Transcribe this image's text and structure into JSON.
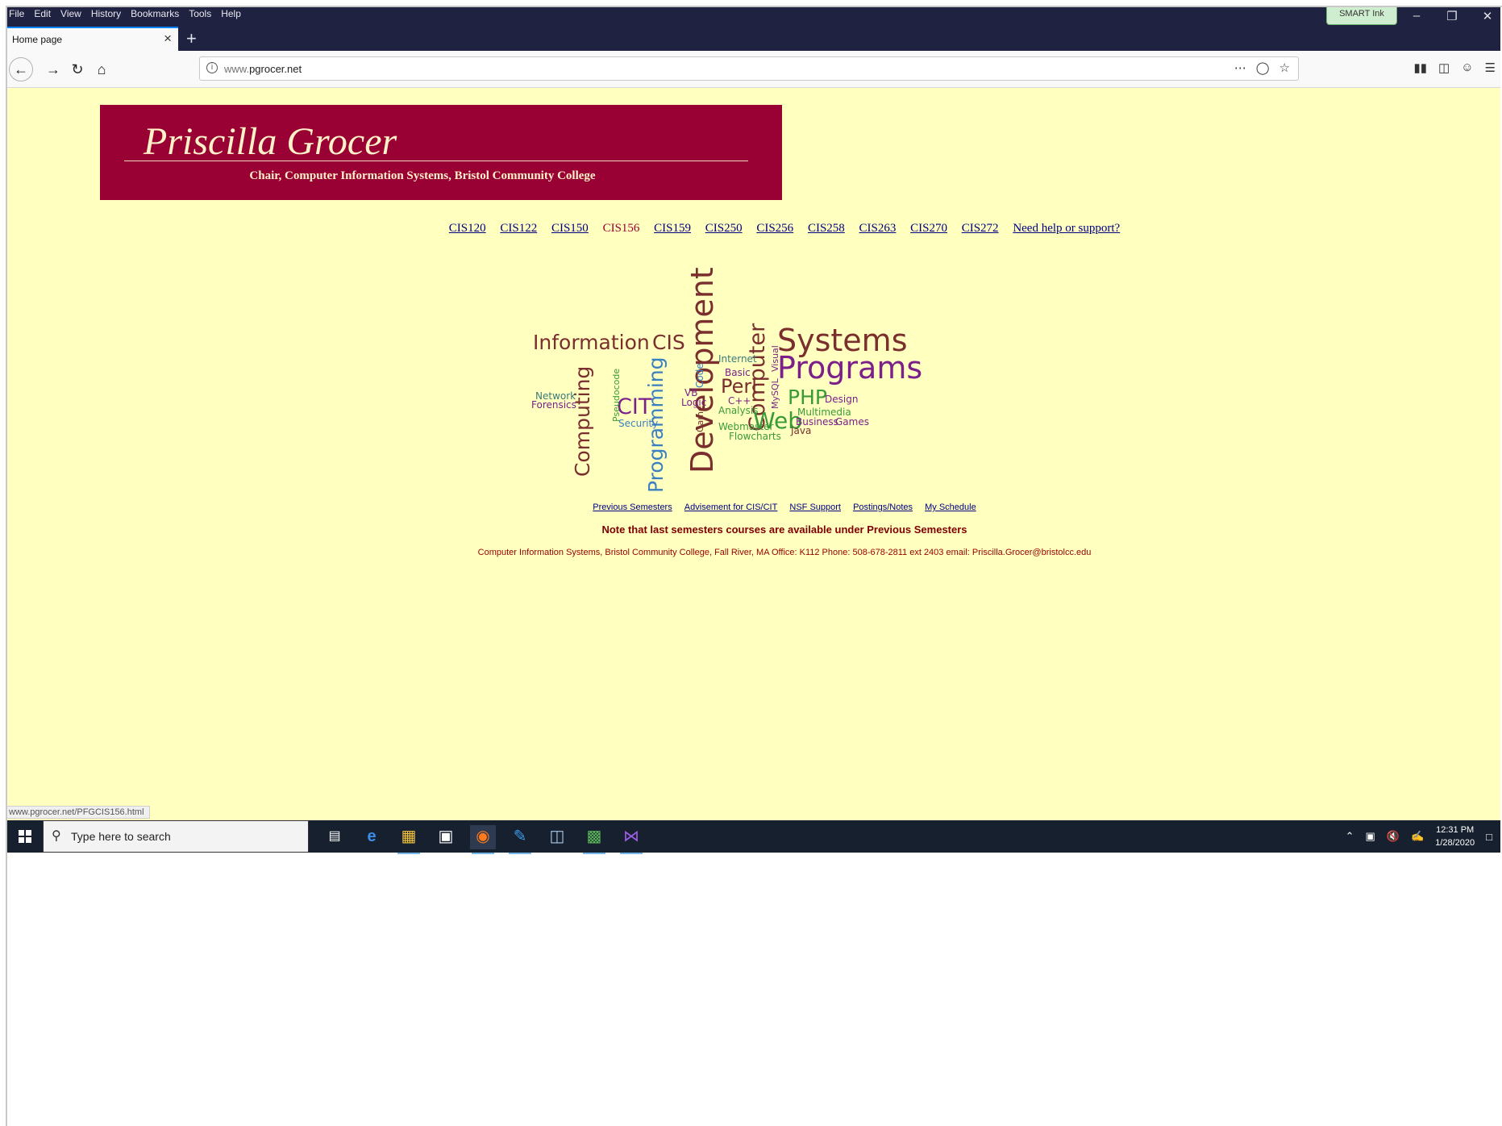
{
  "browser": {
    "menu": [
      "File",
      "Edit",
      "View",
      "History",
      "Bookmarks",
      "Tools",
      "Help"
    ],
    "smart_ink": "SMART Ink",
    "tab_title": "Home page",
    "url_domain": "www.",
    "url_host": "pgrocer.net",
    "status_url": "www.pgrocer.net/PFGCIS156.html"
  },
  "page": {
    "name": "Priscilla Grocer",
    "subtitle": "Chair,  Computer Information Systems,  Bristol Community College",
    "courses": [
      "CIS120",
      "CIS122",
      "CIS150",
      "CIS156",
      "CIS159",
      "CIS250",
      "CIS256",
      "CIS258",
      "CIS263",
      "CIS270",
      "CIS272"
    ],
    "active_course": "CIS156",
    "help_link": "Need help or support?",
    "word_cloud": [
      "Information",
      "CIS",
      "Systems",
      "Programs",
      "Development",
      "Computer",
      "Computing",
      "Programming",
      "CIT",
      "Web",
      "PHP",
      "Perl",
      "Internet",
      "Basic",
      "Visual",
      "MySQL",
      "Code",
      "Game",
      "Logic",
      "VB",
      "C++",
      "Analysis",
      "Design",
      "Multimedia",
      "Business",
      "Games",
      "Java",
      "Webmaster",
      "Flowcharts",
      "Network",
      "Forensics",
      "Pseudocode",
      "Security"
    ],
    "footer_links": [
      "Previous Semesters",
      "Advisement for CIS/CIT",
      "NSF Support",
      "Postings/Notes",
      "My Schedule"
    ],
    "note": "Note that last semesters courses are available under Previous Semesters",
    "contact": "Computer Information Systems, Bristol Community College, Fall River, MA Office: K112 Phone: 508-678-2811 ext 2403 email: Priscilla.Grocer@bristolcc.edu"
  },
  "taskbar": {
    "search_placeholder": "Type here to search",
    "time": "12:31 PM",
    "date": "1/28/2020"
  },
  "colors": {
    "page_bg": "#ffffc0",
    "banner_bg": "#990033",
    "link": "#000080",
    "note": "#800000"
  }
}
